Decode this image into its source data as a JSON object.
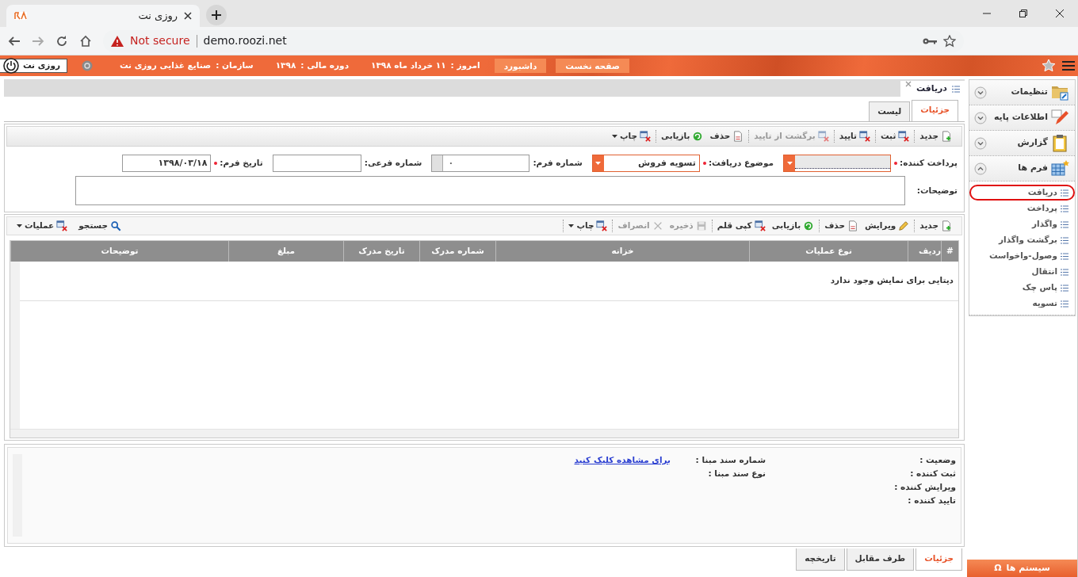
{
  "browser": {
    "tab_title": "روزی نت",
    "address_warning": "Not secure",
    "address": "demo.roozi.net"
  },
  "header": {
    "nav_buttons": [
      "صفحه نخست",
      "داشبورد"
    ],
    "info": [
      {
        "label": "امروز :",
        "value": "۱۱ خرداد ماه ۱۳۹۸"
      },
      {
        "label": "دوره مالی :",
        "value": "۱۳۹۸"
      },
      {
        "label": "سازمان :",
        "value": "صنایع غذایی روزی نت"
      }
    ],
    "user": "روزی نت"
  },
  "document_tab": {
    "title": "دریافت"
  },
  "view_tabs": [
    {
      "label": "جزئیات",
      "selected": true
    },
    {
      "label": "لیست",
      "selected": false
    }
  ],
  "toolbar": {
    "groups": [
      [
        {
          "label": "جدید",
          "kind": "new",
          "disabled": false,
          "dropdown": false
        }
      ],
      [
        {
          "label": "ثبت",
          "kind": "window",
          "disabled": false,
          "dropdown": false
        }
      ],
      [
        {
          "label": "تایید",
          "kind": "window",
          "disabled": false,
          "dropdown": false
        }
      ],
      [
        {
          "label": "برگشت از تایید",
          "kind": "window",
          "disabled": true,
          "dropdown": false
        }
      ],
      [
        {
          "label": "حذف",
          "kind": "page",
          "disabled": false,
          "dropdown": false
        },
        {
          "label": "بازیابی",
          "kind": "refresh",
          "disabled": false,
          "dropdown": false
        }
      ],
      [
        {
          "label": "چاپ",
          "kind": "window",
          "disabled": false,
          "dropdown": true
        }
      ]
    ]
  },
  "form": {
    "fields": [
      {
        "label": "پرداخت کننده:",
        "kind": "combo",
        "required": true
      },
      {
        "label": "موضوع دریافت:",
        "kind": "combo",
        "required": true,
        "value": "تسویه فروش"
      },
      {
        "label": "شماره فرم:",
        "kind": "spinner",
        "required": false,
        "value": "۰"
      },
      {
        "label": "شماره فرعی:",
        "kind": "text",
        "required": false
      },
      {
        "label": "تاریخ فرم:",
        "kind": "date",
        "required": true,
        "value": "۱۳۹۸/۰۳/۱۸"
      },
      {
        "label": "توضیحات:",
        "kind": "textarea",
        "required": false
      }
    ]
  },
  "grid_toolbar": {
    "groups": [
      [
        {
          "label": "جدید",
          "kind": "new",
          "disabled": false,
          "dropdown": false
        }
      ],
      [
        {
          "label": "ویرایش",
          "kind": "pencil",
          "disabled": false,
          "dropdown": false
        },
        {
          "label": "حذف",
          "kind": "page",
          "disabled": false,
          "dropdown": false
        }
      ],
      [
        {
          "label": "بازیابی",
          "kind": "refresh",
          "disabled": false,
          "dropdown": false
        },
        {
          "label": "کپی قلم",
          "kind": "window",
          "disabled": false,
          "dropdown": false
        }
      ],
      [
        {
          "label": "ذخیره",
          "kind": "disk",
          "disabled": true,
          "dropdown": false
        },
        {
          "label": "انصراف",
          "kind": "x",
          "disabled": true,
          "dropdown": false
        }
      ],
      [
        {
          "label": "چاپ",
          "kind": "window",
          "disabled": false,
          "dropdown": true
        }
      ]
    ],
    "end_items": [
      {
        "label": "جستجو",
        "kind": "search",
        "disabled": false,
        "dropdown": false
      },
      {
        "label": "عملیات",
        "kind": "window",
        "disabled": false,
        "dropdown": true
      }
    ]
  },
  "table": {
    "columns": [
      "#",
      "ردیف",
      "نوع عملیات",
      "خزانه",
      "شماره مدرک",
      "تاریخ مدرک",
      "مبلغ",
      "توضیحات"
    ],
    "empty_message": "دیتایی برای نمایش وجود ندارد"
  },
  "info_panel": {
    "columns": [
      [
        {
          "label": "وضعیت :"
        },
        {
          "label": "ثبت کننده :"
        },
        {
          "label": "ویرایش کننده :"
        },
        {
          "label": "تایید کننده :"
        }
      ],
      [
        {
          "label": "شماره سند مبنا :",
          "link": "برای مشاهده کلیک کنید"
        },
        {
          "label": "نوع سند مبنا :"
        }
      ]
    ]
  },
  "bottom_tabs": [
    {
      "label": "جزئیات",
      "selected": true
    },
    {
      "label": "طرف مقابل",
      "selected": false
    },
    {
      "label": "تاریخچه",
      "selected": false
    }
  ],
  "sidebar": {
    "sections": [
      {
        "label": "تنظیمات",
        "kind": "folder",
        "expanded": false
      },
      {
        "label": "اطلاعات پایه",
        "kind": "pencil",
        "expanded": false
      },
      {
        "label": "گزارش",
        "kind": "clipboard",
        "expanded": false
      },
      {
        "label": "فرم ها",
        "kind": "table",
        "expanded": true,
        "children": [
          {
            "label": "دریافت",
            "selected": true
          },
          {
            "label": "پرداخت",
            "selected": false
          },
          {
            "label": "واگذار",
            "selected": false
          },
          {
            "label": "برگشت واگذار",
            "selected": false
          },
          {
            "label": "وصول-واخواست",
            "selected": false
          },
          {
            "label": "انتقال",
            "selected": false
          },
          {
            "label": "پاس چک",
            "selected": false
          },
          {
            "label": "تسویه",
            "selected": false
          }
        ]
      }
    ],
    "systems_button": {
      "symbol": "Ω",
      "label": "سیستم ها"
    }
  }
}
